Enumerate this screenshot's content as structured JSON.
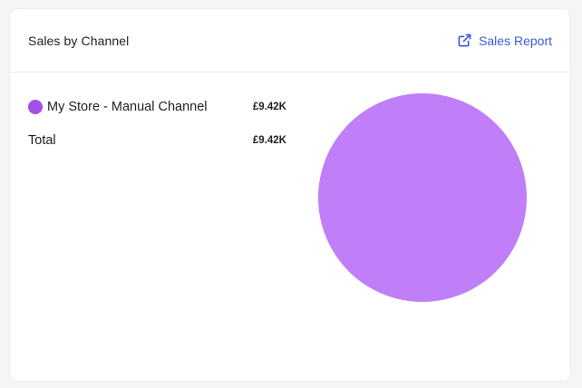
{
  "card": {
    "title": "Sales by Channel",
    "report_link_label": "Sales Report",
    "report_icon": "external-link-icon"
  },
  "legend": {
    "rows": [
      {
        "label": "My Store - Manual Channel",
        "value": "£9.42K",
        "color": "#a34fe8"
      }
    ],
    "total": {
      "label": "Total",
      "value": "£9.42K"
    }
  },
  "chart_data": {
    "type": "pie",
    "categories": [
      "My Store - Manual Channel"
    ],
    "values": [
      9.42
    ],
    "colors": [
      "#c07ef8"
    ]
  }
}
